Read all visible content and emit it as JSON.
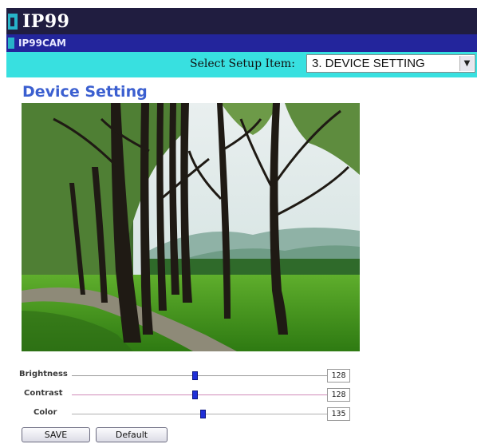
{
  "header": {
    "brand": "IP99",
    "camera_name": "IP99CAM"
  },
  "setup": {
    "label": "Select Setup Item:",
    "selected": "3. DEVICE SETTING"
  },
  "page": {
    "title": "Device Setting"
  },
  "controls": [
    {
      "label": "Brightness",
      "value": "128",
      "level": 0.5
    },
    {
      "label": "Contrast",
      "value": "128",
      "level": 0.5
    },
    {
      "label": "Color",
      "value": "135",
      "level": 0.53
    }
  ],
  "buttons": {
    "save": "SAVE",
    "default": "Default"
  },
  "colors": {
    "header_bg": "#201d40",
    "camrow_bg": "#23259c",
    "setupbar_bg": "#38e0e0",
    "title": "#3b5fd0",
    "slider_thumb": "#1f2fd8"
  }
}
